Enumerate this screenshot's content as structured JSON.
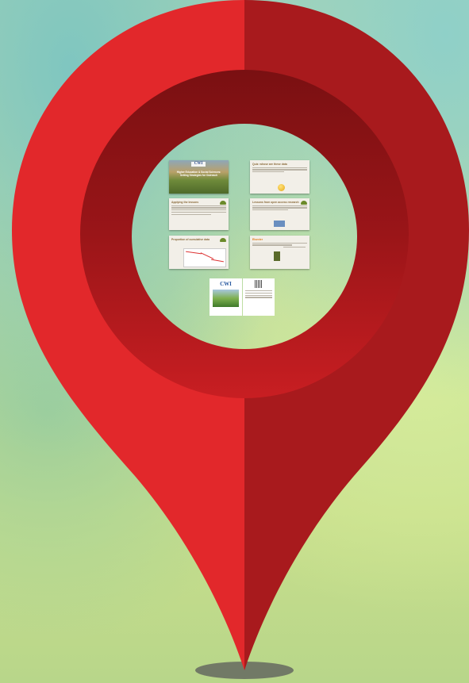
{
  "scene": {
    "background": "blurred green-teal gradient",
    "pin_color_light": "#e2282b",
    "pin_color_dark": "#a81a1d",
    "ring_inner_dark": "#8e1416",
    "shadow_color": "#555555"
  },
  "slides": {
    "title_slide": {
      "logo": "CWI",
      "title": "Higher Education & Social Sciences: Setting Strategies for Outreach",
      "icon": "title-photo"
    },
    "slide_2": {
      "heading": "Quiz: whose are these data",
      "icon": "smiley-icon"
    },
    "slide_3": {
      "heading": "Applying the lessons",
      "icon": "leaf-logo-icon"
    },
    "slide_4": {
      "heading": "Lessons from open access research",
      "icon": "leaf-logo-icon"
    },
    "slide_5": {
      "heading": "Proportion of cumulative data",
      "icon": "chart-icon"
    },
    "slide_6": {
      "heading": "Elsevier",
      "icon": "book-icon"
    },
    "poster": {
      "logo": "CWI",
      "icon": "qr-code-icon"
    }
  }
}
